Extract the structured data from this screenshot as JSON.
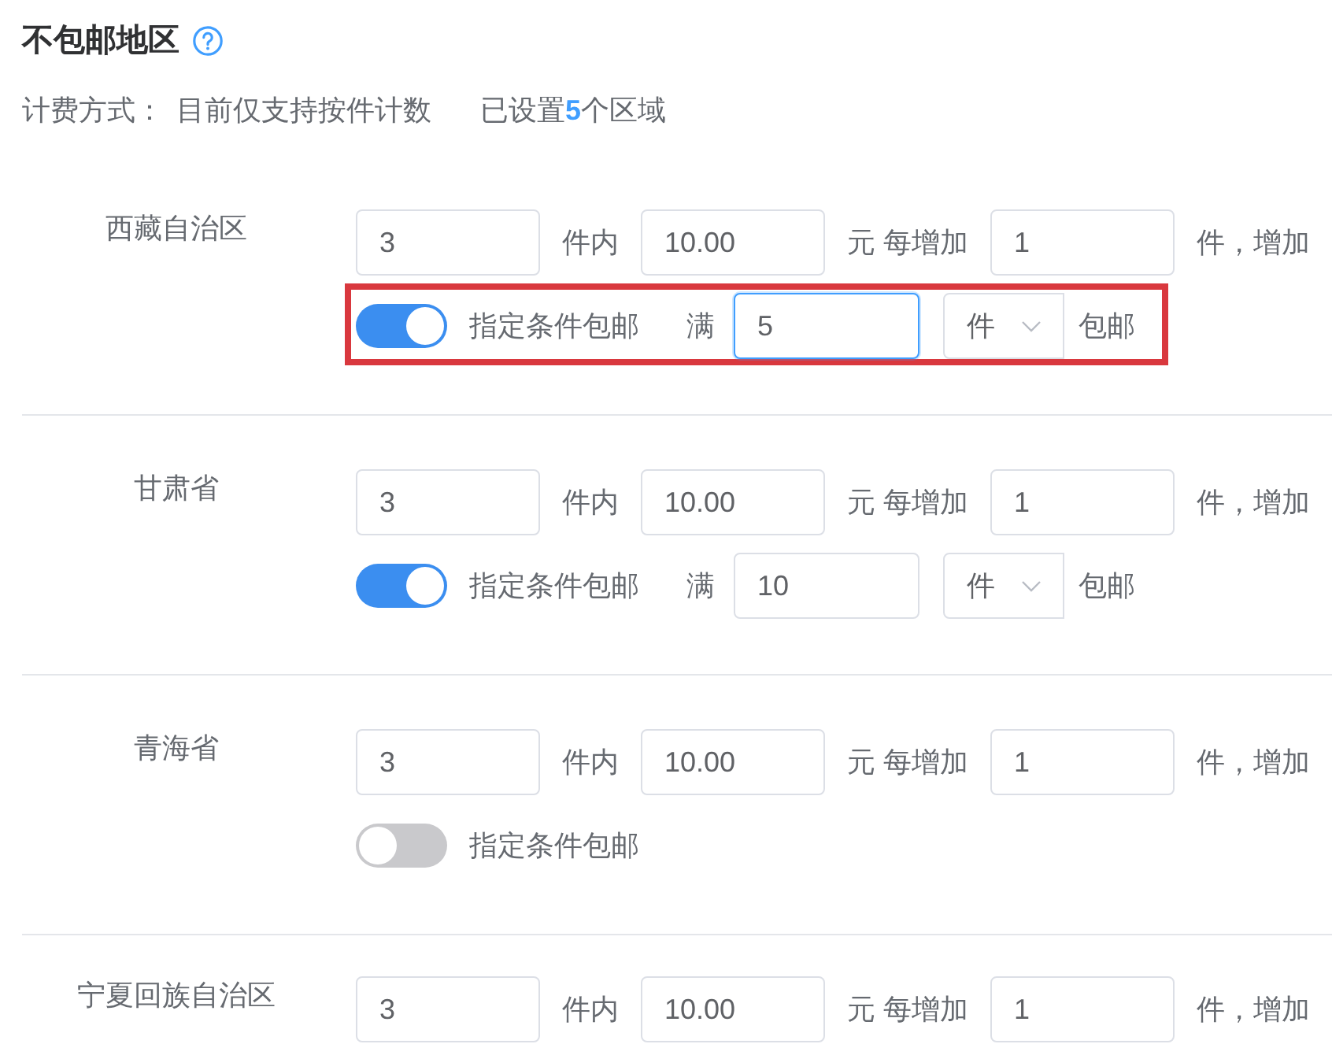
{
  "header": {
    "title": "不包邮地区",
    "billing_label": "计费方式：",
    "billing_value": "目前仅支持按件计数",
    "summary": "已设置**5**个区域"
  },
  "regions": [
    {
      "name": "西藏自治区",
      "first_quantity": "3",
      "first_quantity_unit": "件内",
      "first_fee": "10.00",
      "fee_unit": "元 每增加",
      "extra_quantity": "1",
      "extra_unit": "件，增加",
      "highlighted": true,
      "free_shipping": {
        "on": true,
        "label": "指定条件包邮",
        "threshold_prefix": "满",
        "threshold": "5",
        "focused": true,
        "unit": "件",
        "suffix": "包邮"
      }
    },
    {
      "name": "甘肃省",
      "first_quantity": "3",
      "first_quantity_unit": "件内",
      "first_fee": "10.00",
      "fee_unit": "元 每增加",
      "extra_quantity": "1",
      "extra_unit": "件，增加",
      "highlighted": false,
      "free_shipping": {
        "on": true,
        "label": "指定条件包邮",
        "threshold_prefix": "满",
        "threshold": "10",
        "focused": false,
        "unit": "件",
        "suffix": "包邮"
      }
    },
    {
      "name": "青海省",
      "first_quantity": "3",
      "first_quantity_unit": "件内",
      "first_fee": "10.00",
      "fee_unit": "元 每增加",
      "extra_quantity": "1",
      "extra_unit": "件，增加",
      "highlighted": false,
      "free_shipping": {
        "on": false,
        "label": "指定条件包邮"
      }
    },
    {
      "name": "宁夏回族自治区",
      "first_quantity": "3",
      "first_quantity_unit": "件内",
      "first_fee": "10.00",
      "fee_unit": "元 每增加",
      "extra_quantity": "1",
      "extra_unit": "件，增加"
    }
  ]
}
